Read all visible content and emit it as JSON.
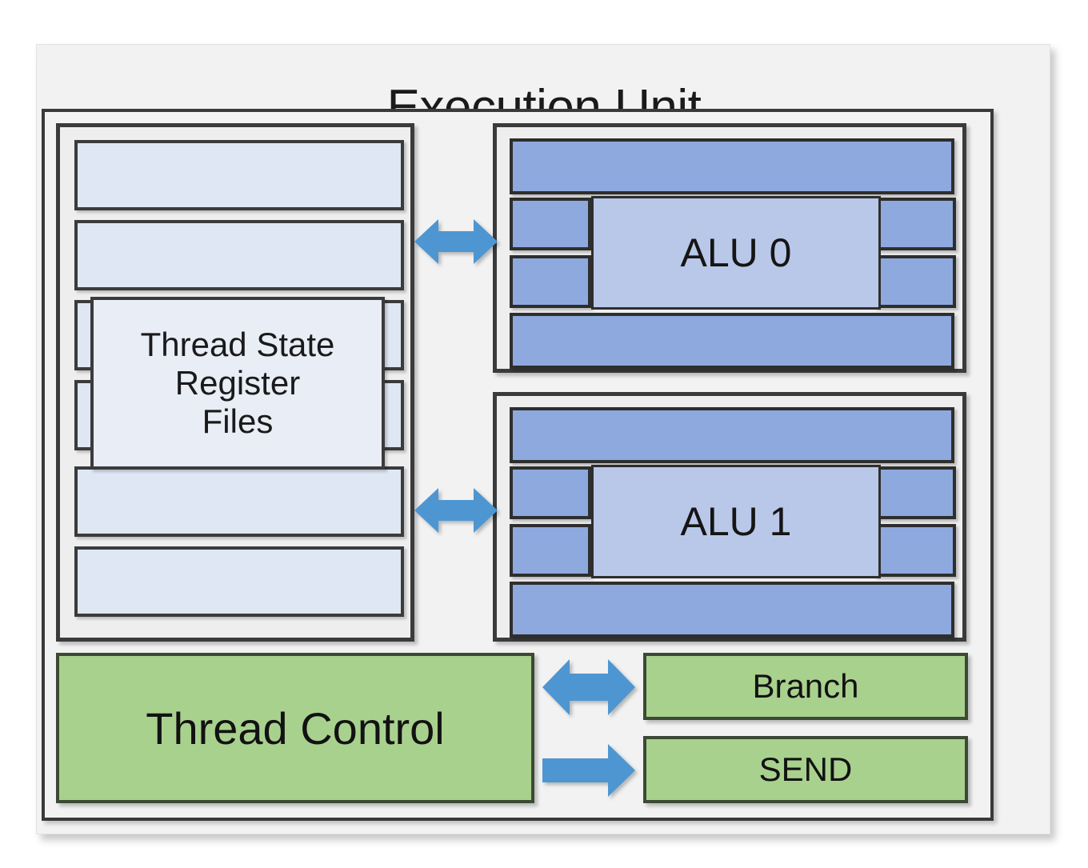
{
  "diagram": {
    "title": "Execution Unit",
    "register_file": {
      "bar_count": 6,
      "label_lines": [
        "Thread State",
        "Register",
        "Files"
      ]
    },
    "alus": [
      {
        "name": "ALU 0",
        "bar_count": 4
      },
      {
        "name": "ALU 1",
        "bar_count": 4
      }
    ],
    "control": {
      "thread_control": "Thread Control",
      "branch": "Branch",
      "send": "SEND"
    },
    "arrows": [
      {
        "id": "rf-alu0",
        "kind": "double-arrow-icon"
      },
      {
        "id": "rf-alu1",
        "kind": "double-arrow-icon"
      },
      {
        "id": "tc-branch",
        "kind": "double-arrow-icon"
      },
      {
        "id": "tc-send",
        "kind": "right-arrow-icon"
      }
    ],
    "colors": {
      "background": "#f2f2f2",
      "register_bar": "#dee7f3",
      "register_label": "#e8edf6",
      "alu_bar": "#8ea9de",
      "alu_label": "#b9c8e8",
      "green": "#a9d18e",
      "arrow": "#4e96d2",
      "border": "#3b3b3b"
    }
  }
}
